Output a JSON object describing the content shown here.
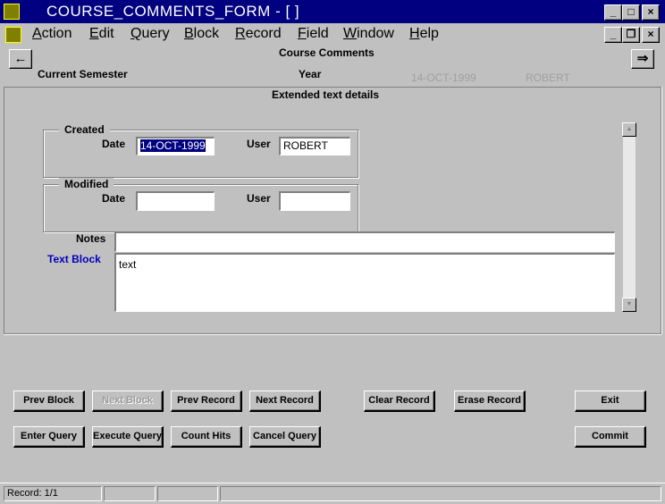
{
  "window": {
    "title": "COURSE_COMMENTS_FORM - [ ]",
    "minimize": "_",
    "maximize": "□",
    "close": "×"
  },
  "menubar": {
    "items": [
      {
        "label": "Action",
        "ul": "A",
        "rest": "ction"
      },
      {
        "label": "Edit",
        "ul": "E",
        "rest": "dit"
      },
      {
        "label": "Query",
        "ul": "Q",
        "rest": "uery"
      },
      {
        "label": "Block",
        "ul": "B",
        "rest": "lock"
      },
      {
        "label": "Record",
        "ul": "R",
        "rest": "ecord"
      },
      {
        "label": "Field",
        "ul": "F",
        "rest": "ield"
      },
      {
        "label": "Window",
        "ul": "W",
        "rest": "indow"
      },
      {
        "label": "Help",
        "ul": "H",
        "rest": "elp"
      }
    ],
    "doc_minimize": "_",
    "doc_restore": "❐",
    "doc_close": "×"
  },
  "header": {
    "form_title": "Course Comments",
    "current_semester_label": "Current Semester",
    "year_label": "Year",
    "date_value": "14-OCT-1999",
    "user_value": "ROBERT",
    "prev_arrow": "←",
    "next_arrow": "⇒"
  },
  "panel": {
    "title": "Extended text details",
    "created": {
      "title": "Created",
      "date_label": "Date",
      "date_value": "14-OCT-1999",
      "user_label": "User",
      "user_value": "ROBERT"
    },
    "modified": {
      "title": "Modified",
      "date_label": "Date",
      "date_value": "",
      "user_label": "User",
      "user_value": ""
    },
    "notes_label": "Notes",
    "notes_value": "",
    "text_block_label": "Text Block",
    "text_block_value": "text"
  },
  "buttons": {
    "prev_block": "Prev Block",
    "next_block": "Next Block",
    "prev_record": "Prev Record",
    "next_record": "Next Record",
    "clear_record": "Clear Record",
    "erase_record": "Erase Record",
    "exit": "Exit",
    "enter_query": "Enter Query",
    "execute_query": "Execute Query",
    "count_hits": "Count Hits",
    "cancel_query": "Cancel Query",
    "commit": "Commit"
  },
  "status": {
    "record": "Record: 1/1"
  },
  "colors": {
    "title_bar": "#000080",
    "face": "#c0c0c0",
    "text_block_label": "#0000c0",
    "selection": "#000080"
  }
}
